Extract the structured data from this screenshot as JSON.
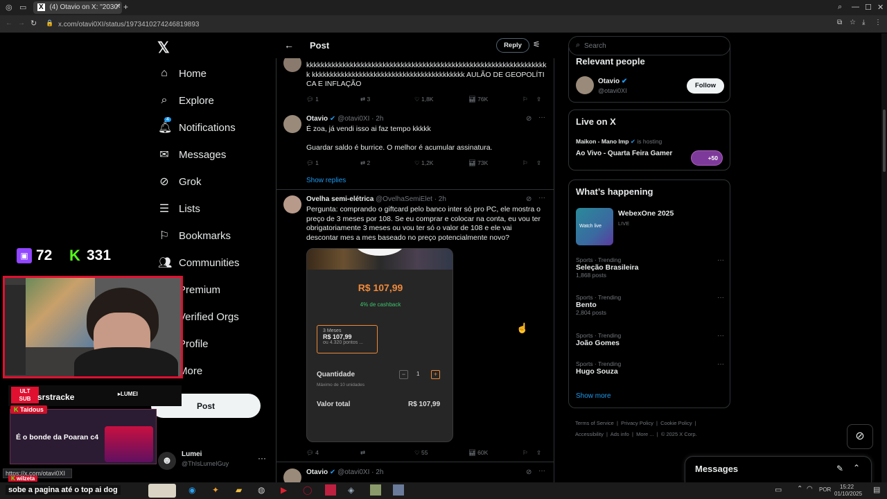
{
  "browser": {
    "tab_title": "(4) Otavio on X: \"2030\"",
    "url": "x.com/otavi0XI/status/1973410274246819893",
    "status_url": "https://x.com/otavi0XI"
  },
  "nav": {
    "items": [
      {
        "label": "Home"
      },
      {
        "label": "Explore"
      },
      {
        "label": "Notifications",
        "badge": "4"
      },
      {
        "label": "Messages"
      },
      {
        "label": "Grok"
      },
      {
        "label": "Lists"
      },
      {
        "label": "Bookmarks"
      },
      {
        "label": "Communities"
      },
      {
        "label": "Premium"
      },
      {
        "label": "Verified Orgs"
      },
      {
        "label": "Profile"
      },
      {
        "label": "More"
      }
    ],
    "post_button": "Post",
    "account": {
      "name": "Lumei",
      "handle": "@ThIsLumeIGuy"
    }
  },
  "post_header": {
    "title": "Post",
    "reply_button": "Reply"
  },
  "tweets": [
    {
      "text": "kkkkkkkkkkkkkkkkkkkkkkkkkkkkkkkkkkkkkkkkkkkkkkkkkkkkkkkkkkkkkkkkkkk kkkkkkkkkkkkkkkkkkkkkkkkkkkkkkkkkkkkkkkkkk AULÃO DE GEOPOLÍTICA E INFLAÇÃO",
      "replies": "1",
      "reposts": "3",
      "likes": "1,8K",
      "views": "76K"
    },
    {
      "name": "Otavio",
      "handle": "@otavi0XI",
      "time": "· 2h",
      "text1": "É zoa, já vendi isso ai faz tempo kkkkk",
      "text2": "Guardar saldo é burrice. O melhor é acumular assinatura.",
      "replies": "1",
      "reposts": "2",
      "likes": "1,2K",
      "views": "73K",
      "show_replies": "Show replies"
    },
    {
      "name": "Ovelha semi-elétrica",
      "handle": "@OvelhaSemiElet",
      "time": "· 2h",
      "text": "Pergunta: comprando o giftcard pelo banco inter só pro PC, ele mostra o preço de 3 meses por 108. Se eu comprar e colocar na conta, eu vou ter obrigatoriamente 3 meses ou vou ter só o valor de 108 e ele vai descontar mes a mes baseado no preço potencialmente novo?",
      "replies": "4",
      "reposts": "",
      "likes": "55",
      "views": "60K",
      "card": {
        "price": "R$ 107,99",
        "cashback": "4% de cashback",
        "option_title": "3 Meses",
        "option_price": "R$ 107,99",
        "option_points": "ou 4.320 pontos ...",
        "qty_label": "Quantidade",
        "qty_hint": "Máximo de 10 unidades",
        "qty_value": "1",
        "qty_minus": "−",
        "qty_plus": "+",
        "total_label": "Valor total",
        "total_value": "R$ 107,99"
      }
    },
    {
      "name": "Otavio",
      "handle": "@otavi0XI",
      "time": "· 2h"
    }
  ],
  "right": {
    "search_placeholder": "Search",
    "relevant": {
      "title": "Relevant people",
      "name": "Otavio",
      "handle": "@otavi0XI",
      "follow": "Follow"
    },
    "live": {
      "title": "Live on X",
      "host": "Maikon - Mano Imp",
      "hosting": "is hosting",
      "stream": "Ao Vivo - Quarta Feira Gamer",
      "count": "+50"
    },
    "happening": {
      "title": "What’s happening",
      "event_name": "WebexOne 2025",
      "event_status": "LIVE",
      "event_thumb": "Watch live",
      "trends": [
        {
          "meta": "Sports · Trending",
          "name": "Seleção Brasileira",
          "posts": "1,868 posts"
        },
        {
          "meta": "Sports · Trending",
          "name": "Bento",
          "posts": "2,804 posts"
        },
        {
          "meta": "Sports · Trending",
          "name": "João Gomes",
          "posts": ""
        },
        {
          "meta": "Sports · Trending",
          "name": "Hugo Souza",
          "posts": ""
        }
      ],
      "show_more": "Show more"
    },
    "footer": [
      "Terms of Service",
      "Privacy Policy",
      "Cookie Policy",
      "Accessibility",
      "Ads info",
      "More ...",
      "© 2025 X Corp."
    ],
    "messages_label": "Messages"
  },
  "stream_overlay": {
    "twitch_count": "72",
    "kick_count": "331",
    "ult_sub_user": "srstracke",
    "chat_user": "Taidous",
    "chat_text": "É o bonde da Poaran c4",
    "lower_user": "wilzeta",
    "ticker": "sobe a pagina até o top ai dog"
  },
  "taskbar": {
    "lang": "POR",
    "time": "15:22",
    "date": "01/10/2025"
  }
}
